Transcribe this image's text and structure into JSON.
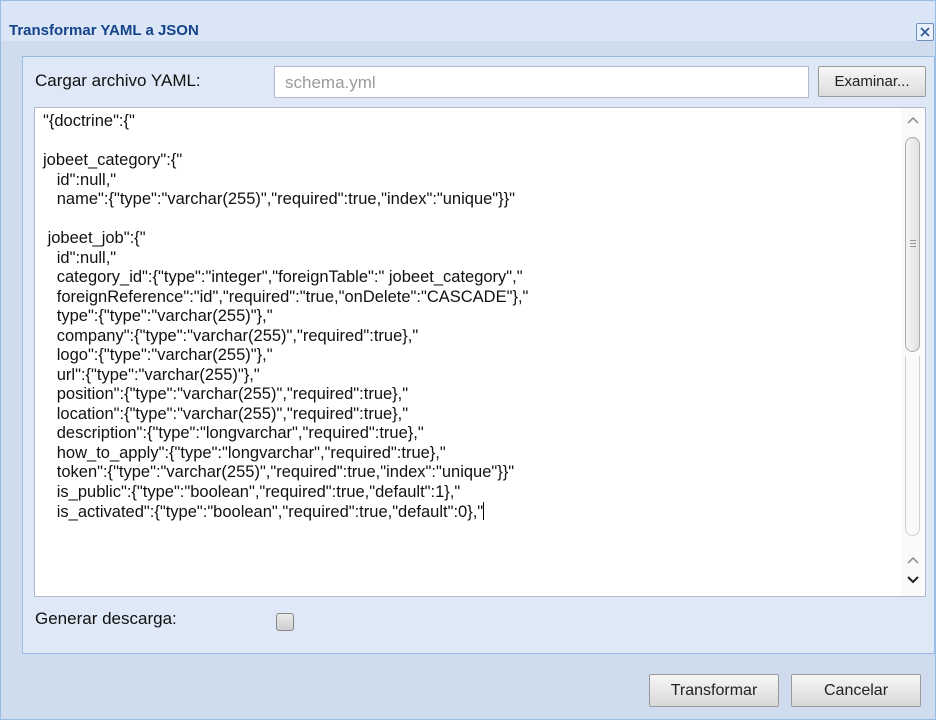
{
  "window": {
    "title": "Transformar YAML a JSON",
    "close_icon": "close-icon"
  },
  "form": {
    "file_label": "Cargar archivo YAML:",
    "file_value": "schema.yml",
    "browse_label": "Examinar...",
    "download_label": "Generar descarga:",
    "download_checked": false
  },
  "output": {
    "lines": [
      "\"{doctrine\":{\"",
      "",
      "jobeet_category\":{\"",
      "   id\":null,\"",
      "   name\":{\"type\":\"varchar(255)\",\"required\":true,\"index\":\"unique\"}}\"",
      "",
      " jobeet_job\":{\"",
      "   id\":null,\"",
      "   category_id\":{\"type\":\"integer\",\"foreignTable\":\" jobeet_category\",\"",
      "   foreignReference\":\"id\",\"required\":\"true,\"onDelete\":\"CASCADE\"},\"",
      "   type\":{\"type\":\"varchar(255)\"},\"",
      "   company\":{\"type\":\"varchar(255)\",\"required\":true},\"",
      "   logo\":{\"type\":\"varchar(255)\"},\"",
      "   url\":{\"type\":\"varchar(255)\"},\"",
      "   position\":{\"type\":\"varchar(255)\",\"required\":true},\"",
      "   location\":{\"type\":\"varchar(255)\",\"required\":true},\"",
      "   description\":{\"type\":\"longvarchar\",\"required\":true},\"",
      "   how_to_apply\":{\"type\":\"longvarchar\",\"required\":true},\"",
      "   token\":{\"type\":\"varchar(255)\",\"required\":true,\"index\":\"unique\"}}\"",
      "   is_public\":{\"type\":\"boolean\",\"required\":true,\"default\":1},\"",
      "   is_activated\":{\"type\":\"boolean\",\"required\":true,\"default\":0},\""
    ]
  },
  "buttons": {
    "transform": "Transformar",
    "cancel": "Cancelar"
  },
  "colors": {
    "title_text": "#15428b",
    "window_bg": "#cfdcee",
    "panel_bg": "#dfe8f6",
    "border": "#99bbe8"
  }
}
